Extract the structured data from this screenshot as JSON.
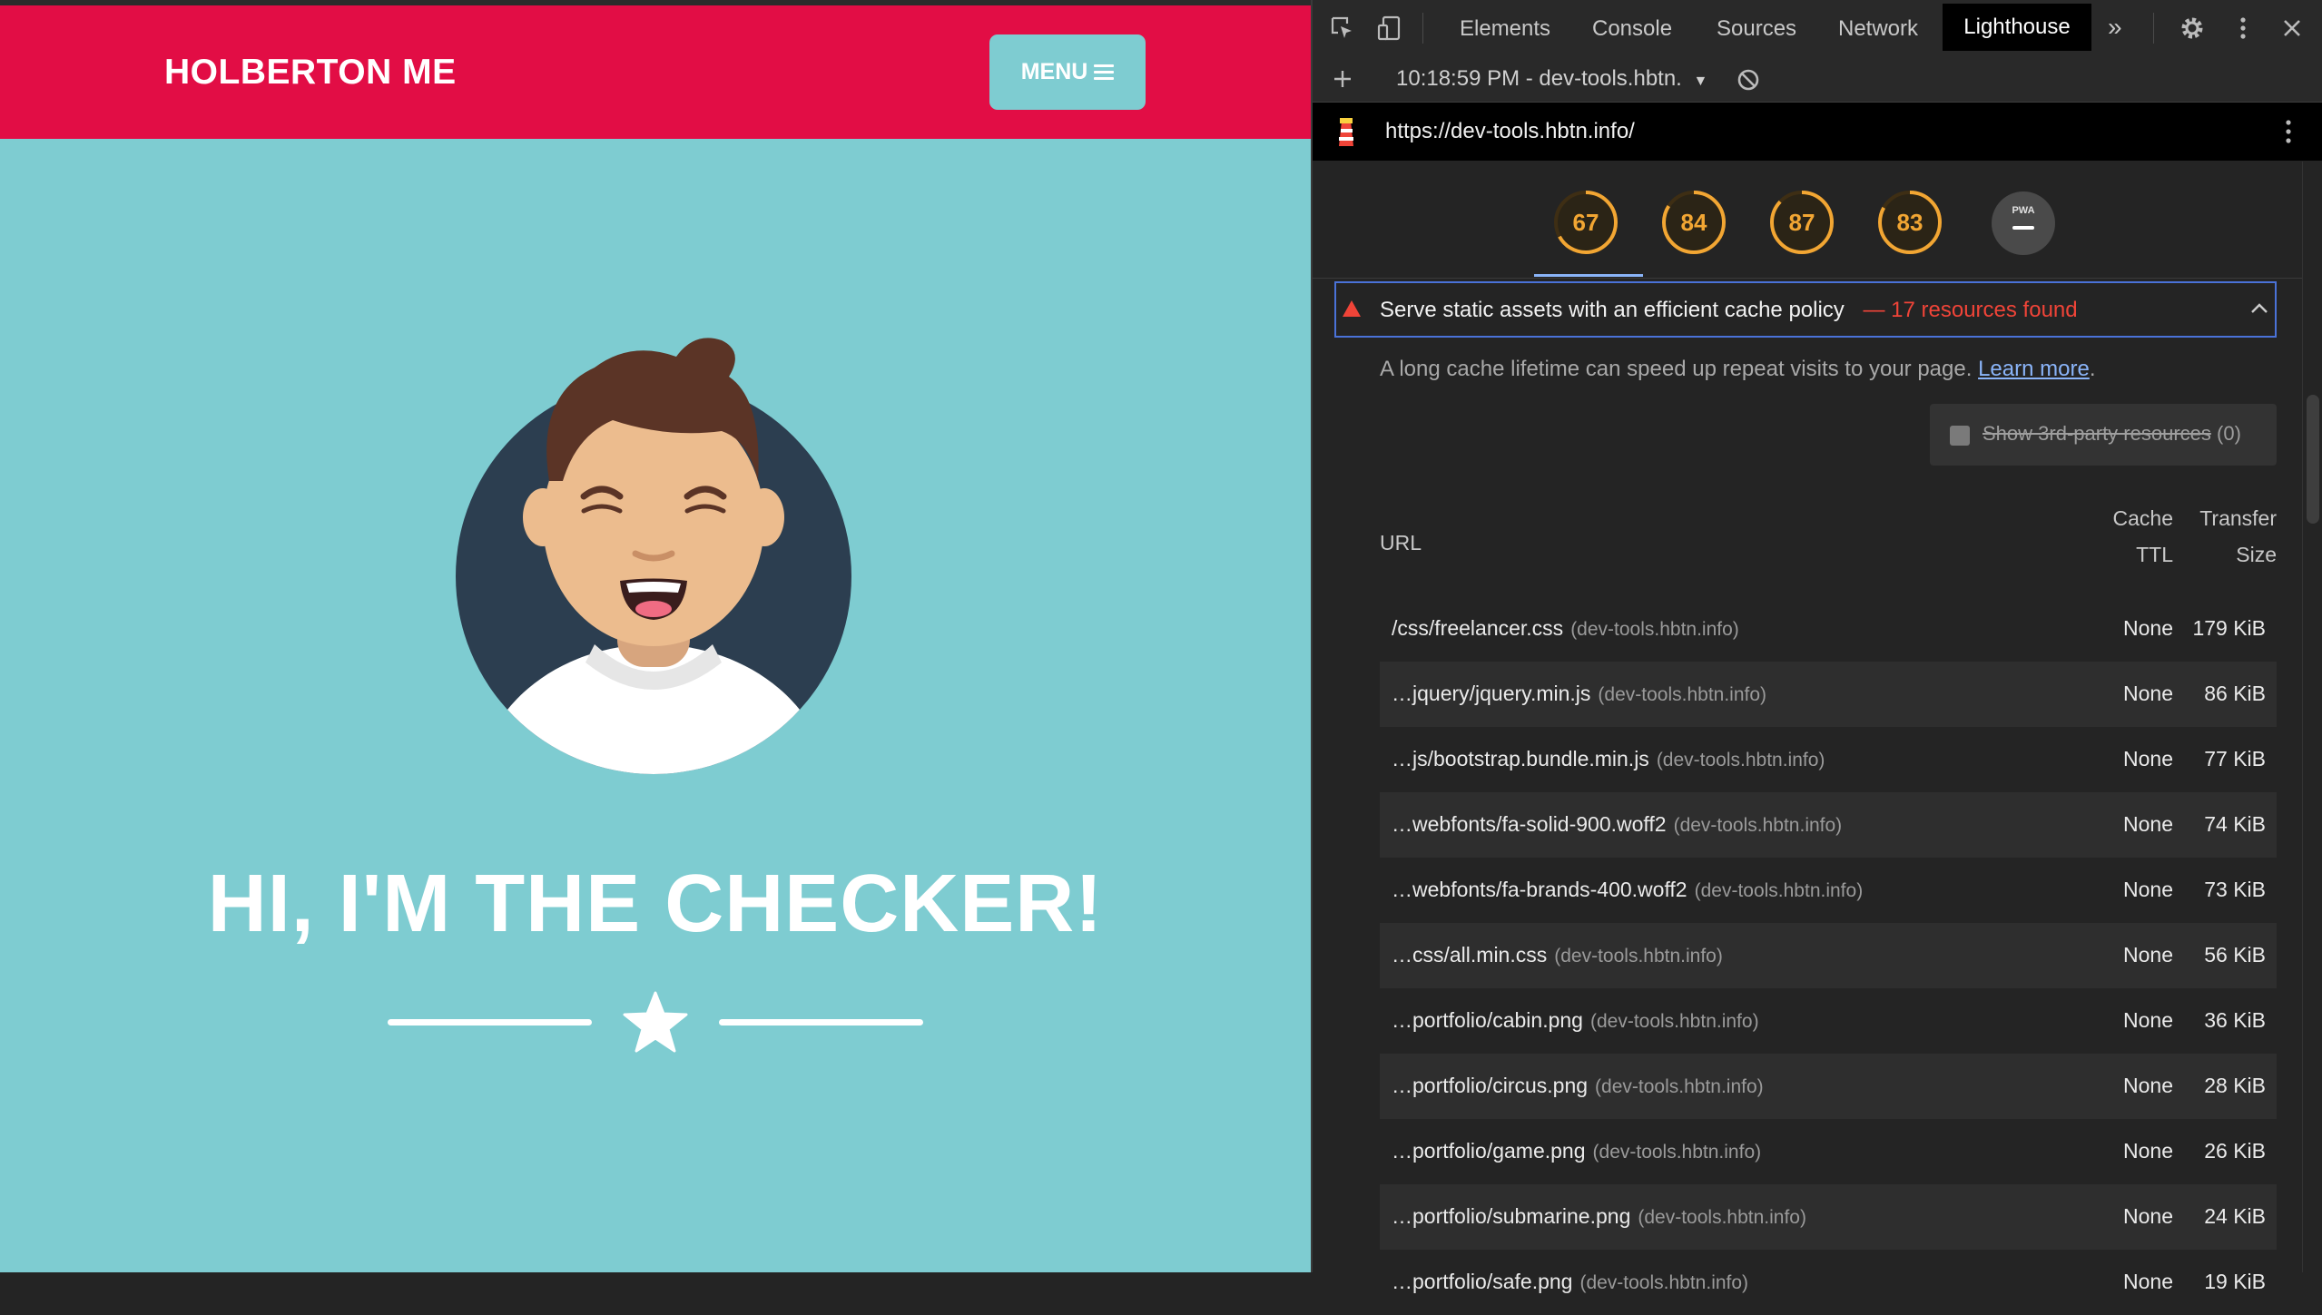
{
  "site": {
    "brand": "HOLBERTON ME",
    "menu_label": "MENU",
    "hero_title": "HI, I'M THE CHECKER!"
  },
  "devtools": {
    "tabs": [
      "Elements",
      "Console",
      "Sources",
      "Network",
      "Lighthouse"
    ],
    "active_tab": "Lighthouse",
    "report_selector": "10:18:59 PM - dev-tools.hbtn.",
    "report_url": "https://dev-tools.hbtn.info/",
    "scores": [
      {
        "value": 67,
        "color": "#F2A633"
      },
      {
        "value": 84,
        "color": "#F2A633"
      },
      {
        "value": 87,
        "color": "#F2A633"
      },
      {
        "value": 83,
        "color": "#F2A633"
      },
      {
        "value": "PWA",
        "color": "#9e9e9e"
      }
    ],
    "audit": {
      "title": "Serve static assets with an efficient cache policy",
      "summary": "— 17 resources found",
      "description": "A long cache lifetime can speed up repeat visits to your page.",
      "learn_more": "Learn more",
      "third_party_label": "Show 3rd-party resources",
      "third_party_count": "(0)",
      "col_url": "URL",
      "col_cache_1": "Cache",
      "col_cache_2": "TTL",
      "col_size_1": "Transfer",
      "col_size_2": "Size",
      "rows": [
        {
          "url": "/css/freelancer.css",
          "domain": "(dev-tools.hbtn.info)",
          "ttl": "None",
          "size": "179 KiB"
        },
        {
          "url": "…jquery/jquery.min.js",
          "domain": "(dev-tools.hbtn.info)",
          "ttl": "None",
          "size": "86 KiB"
        },
        {
          "url": "…js/bootstrap.bundle.min.js",
          "domain": "(dev-tools.hbtn.info)",
          "ttl": "None",
          "size": "77 KiB"
        },
        {
          "url": "…webfonts/fa-solid-900.woff2",
          "domain": "(dev-tools.hbtn.info)",
          "ttl": "None",
          "size": "74 KiB"
        },
        {
          "url": "…webfonts/fa-brands-400.woff2",
          "domain": "(dev-tools.hbtn.info)",
          "ttl": "None",
          "size": "73 KiB"
        },
        {
          "url": "…css/all.min.css",
          "domain": "(dev-tools.hbtn.info)",
          "ttl": "None",
          "size": "56 KiB"
        },
        {
          "url": "…portfolio/cabin.png",
          "domain": "(dev-tools.hbtn.info)",
          "ttl": "None",
          "size": "36 KiB"
        },
        {
          "url": "…portfolio/circus.png",
          "domain": "(dev-tools.hbtn.info)",
          "ttl": "None",
          "size": "28 KiB"
        },
        {
          "url": "…portfolio/game.png",
          "domain": "(dev-tools.hbtn.info)",
          "ttl": "None",
          "size": "26 KiB"
        },
        {
          "url": "…portfolio/submarine.png",
          "domain": "(dev-tools.hbtn.info)",
          "ttl": "None",
          "size": "24 KiB"
        },
        {
          "url": "…portfolio/safe.png",
          "domain": "(dev-tools.hbtn.info)",
          "ttl": "None",
          "size": "19 KiB"
        }
      ]
    }
  },
  "colors": {
    "site_nav": "#E20D45",
    "site_bg": "#7ECCD1",
    "avatar_circle": "#2C3E50",
    "devtools_bg": "#242424",
    "score_average": "#F2A633",
    "warning_red": "#F04438",
    "focus_blue": "#4A72D8"
  }
}
